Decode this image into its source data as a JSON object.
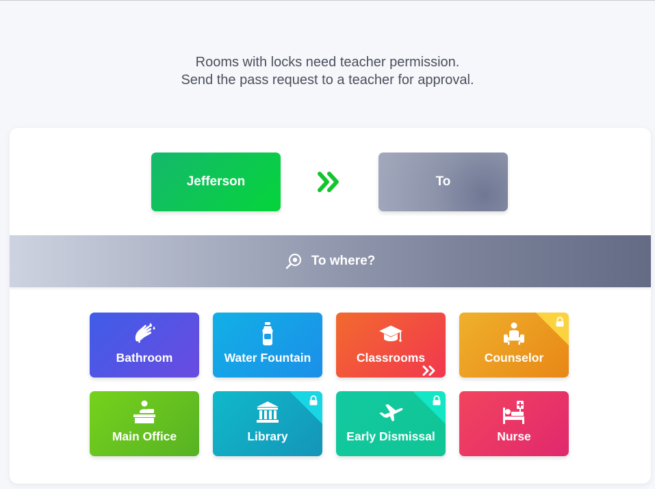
{
  "notice": {
    "line1": "Rooms with locks need teacher permission.",
    "line2": "Send the pass request to a teacher for approval."
  },
  "route": {
    "from_label": "Jefferson",
    "to_label": "To",
    "arrow_color": "#14c42f"
  },
  "search": {
    "label": "To where?"
  },
  "destinations": [
    {
      "label": "Bathroom",
      "icon": "hands-washing-icon",
      "locked": false
    },
    {
      "label": "Water Fountain",
      "icon": "water-bottle-icon",
      "locked": false
    },
    {
      "label": "Classrooms",
      "icon": "graduation-cap-icon",
      "locked": false,
      "has_more": true
    },
    {
      "label": "Counselor",
      "icon": "counselor-icon",
      "locked": true
    },
    {
      "label": "Main Office",
      "icon": "office-desk-icon",
      "locked": false
    },
    {
      "label": "Library",
      "icon": "library-building-icon",
      "locked": true
    },
    {
      "label": "Early Dismissal",
      "icon": "airplane-icon",
      "locked": true
    },
    {
      "label": "Nurse",
      "icon": "nurse-bed-icon",
      "locked": false
    }
  ]
}
